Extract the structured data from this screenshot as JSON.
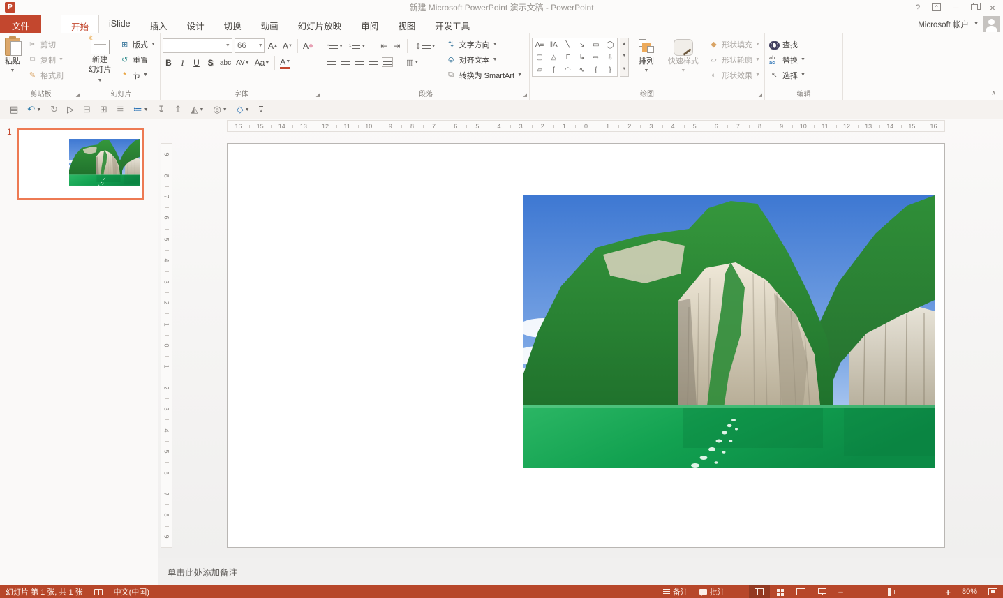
{
  "colors": {
    "accent_red": "#B7472A",
    "file_tab_red": "#C3472E",
    "active_tab_text": "#C3472E",
    "selection_orange": "#ED7A53",
    "sky_blue": "#3E78D2",
    "water_green": "#12A150",
    "slide_border": "#B9B6B3",
    "undo_blue": "#2878A8",
    "qat_blue": "#2E75B6"
  },
  "title_bar": {
    "title": "新建 Microsoft PowerPoint 演示文稿 - PowerPoint",
    "help": "?",
    "minimize": "─",
    "close": "×"
  },
  "account": {
    "label": "Microsoft 帐户"
  },
  "tabs": {
    "file": "文件",
    "items": [
      "开始",
      "iSlide",
      "插入",
      "设计",
      "切换",
      "动画",
      "幻灯片放映",
      "审阅",
      "视图",
      "开发工具"
    ],
    "active_index": 0
  },
  "ribbon": {
    "clipboard": {
      "label": "剪贴板",
      "paste": "粘贴",
      "cut": "剪切",
      "copy": "复制",
      "format_painter": "格式刷",
      "cut_icon": "✂",
      "copy_icon": "⧉",
      "painter_icon": "✎"
    },
    "slides": {
      "label": "幻灯片",
      "new_slide_line1": "新建",
      "new_slide_line2": "幻灯片",
      "layout": "版式",
      "reset": "重置",
      "section": "节",
      "layout_icon": "⊞",
      "reset_icon": "↺",
      "section_icon": "*"
    },
    "font": {
      "label": "字体",
      "name": "",
      "size": "66",
      "bold": "B",
      "italic": "I",
      "underline": "U",
      "shadow": "S",
      "strike": "abc",
      "spacing": "AV",
      "case": "Aa",
      "color": "A",
      "grow": "A",
      "shrink": "A",
      "clear": "A"
    },
    "paragraph": {
      "label": "段落",
      "text_direction": "文字方向",
      "align_text": "对齐文本",
      "smartart": "转换为 SmartArt",
      "text_direction_icon": "⇅",
      "align_text_icon": "⊜",
      "smartart_icon": "⧉",
      "bullet_prefix": "•",
      "number_prefix": "1",
      "outdent_icon": "⇤",
      "indent_icon": "⇥",
      "spacing_icon": "⇕",
      "columns_icon": "▥"
    },
    "drawing": {
      "label": "绘图",
      "arrange": "排列",
      "quick_styles": "快速样式",
      "shape_fill": "形状填充",
      "shape_outline": "形状轮廓",
      "shape_effects": "形状效果",
      "fill_icon": "◆",
      "outline_icon": "▱",
      "effects_icon": "◐",
      "scroll_up": "▲",
      "scroll_down": "▼",
      "scroll_more": "▼",
      "shapes": [
        {
          "name": "text-box-shape",
          "glyph": "A≡"
        },
        {
          "name": "vertical-text-box-shape",
          "glyph": "‖A"
        },
        {
          "name": "line-shape",
          "glyph": "╲"
        },
        {
          "name": "arrow-shape",
          "glyph": "↘"
        },
        {
          "name": "rectangle-shape",
          "glyph": "▭"
        },
        {
          "name": "oval-shape",
          "glyph": "◯"
        },
        {
          "name": "rounded-rectangle-shape",
          "glyph": "▢"
        },
        {
          "name": "triangle-shape",
          "glyph": "△"
        },
        {
          "name": "elbow-connector-shape",
          "glyph": "Γ"
        },
        {
          "name": "elbow-arrow-connector-shape",
          "glyph": "↳"
        },
        {
          "name": "right-arrow-shape",
          "glyph": "⇨"
        },
        {
          "name": "down-arrow-shape",
          "glyph": "⇩"
        },
        {
          "name": "freeform-shape",
          "glyph": "▱"
        },
        {
          "name": "scribble-shape",
          "glyph": "ʃ"
        },
        {
          "name": "arc-shape",
          "glyph": "◠"
        },
        {
          "name": "curve-shape",
          "glyph": "∿"
        },
        {
          "name": "left-brace-shape",
          "glyph": "{"
        },
        {
          "name": "right-brace-shape",
          "glyph": "}"
        }
      ]
    },
    "editing": {
      "label": "编辑",
      "find": "查找",
      "replace": "替换",
      "select": "选择",
      "replace_ab": "ab",
      "replace_ac": "ac",
      "select_icon": "↖"
    }
  },
  "qat": {
    "icons": [
      {
        "name": "save-icon",
        "glyph": "▤",
        "color": "#6D6A67",
        "dropdown": false
      },
      {
        "name": "undo-icon",
        "glyph": "↶",
        "color": "#2878A8",
        "dropdown": true
      },
      {
        "name": "redo-icon",
        "glyph": "↻",
        "color": "#9C9894",
        "dropdown": false
      },
      {
        "name": "start-slideshow-icon",
        "glyph": "▷",
        "color": "#6D6A67",
        "dropdown": false
      },
      {
        "name": "align-center-icon",
        "glyph": "⊟",
        "color": "#8A8682",
        "dropdown": false
      },
      {
        "name": "align-middle-icon",
        "glyph": "⊞",
        "color": "#8A8682",
        "dropdown": false
      },
      {
        "name": "distribute-icon",
        "glyph": "≣",
        "color": "#8A8682",
        "dropdown": false
      },
      {
        "name": "align-objects-icon",
        "glyph": "≔",
        "color": "#2E75B6",
        "dropdown": true
      },
      {
        "name": "distribute-vertical-icon",
        "glyph": "↧",
        "color": "#8A8682",
        "dropdown": false
      },
      {
        "name": "distribute-horizontal-icon",
        "glyph": "↥",
        "color": "#8A8682",
        "dropdown": false
      },
      {
        "name": "rotate-flip-icon",
        "glyph": "◭",
        "color": "#8A8682",
        "dropdown": true
      },
      {
        "name": "merge-shapes-icon",
        "glyph": "◎",
        "color": "#8A8682",
        "dropdown": true
      },
      {
        "name": "change-shape-icon",
        "glyph": "◇",
        "color": "#2E75B6",
        "dropdown": true
      },
      {
        "name": "qat-overflow-icon",
        "glyph": "∨",
        "color": "#6D6A67",
        "dropdown": false
      }
    ]
  },
  "rulers": {
    "horizontal": [
      16,
      15,
      14,
      13,
      12,
      11,
      10,
      9,
      8,
      7,
      6,
      5,
      4,
      3,
      2,
      1,
      0,
      1,
      2,
      3,
      4,
      5,
      6,
      7,
      8,
      9,
      10,
      11,
      12,
      13,
      14,
      15,
      16
    ],
    "vertical": [
      9,
      8,
      7,
      6,
      5,
      4,
      3,
      2,
      1,
      0,
      1,
      2,
      3,
      4,
      5,
      6,
      7,
      8,
      9
    ]
  },
  "thumbnail_panel": {
    "slide_number": "1"
  },
  "notes": {
    "placeholder": "单击此处添加备注"
  },
  "status_bar": {
    "slide_info": "幻灯片 第 1 张, 共 1 张",
    "language": "中文(中国)",
    "notes": "备注",
    "comments": "批注",
    "zoom_level": "80%"
  }
}
